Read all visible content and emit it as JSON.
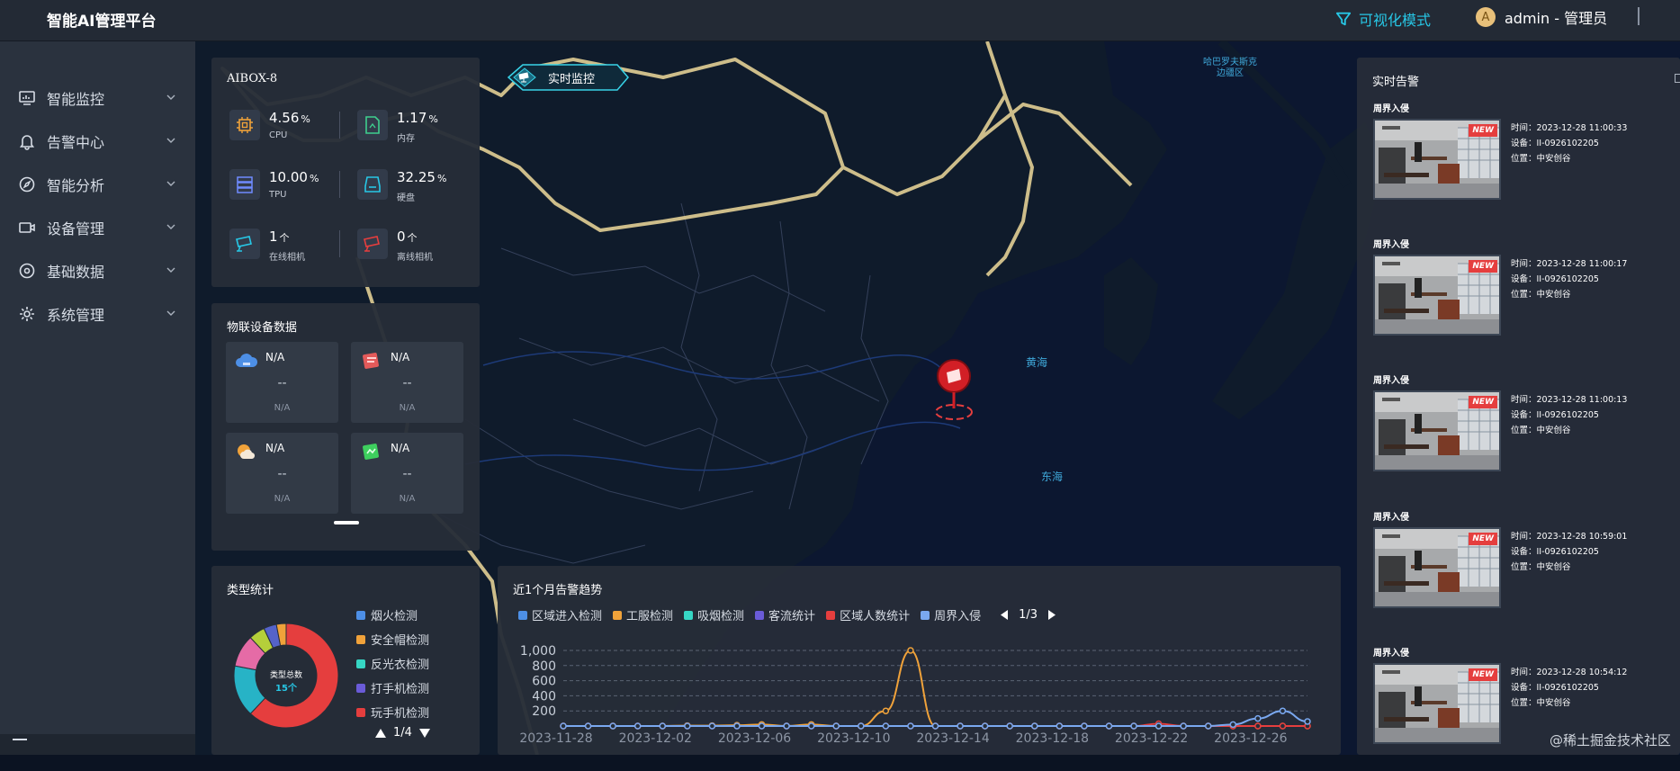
{
  "header": {
    "app_title": "智能AI管理平台",
    "visual_mode": "可视化模式",
    "avatar_initial": "A",
    "user_label": "admin - 管理员"
  },
  "sidebar": {
    "items": [
      {
        "label": "智能监控",
        "icon": "monitor-icon"
      },
      {
        "label": "告警中心",
        "icon": "bell-icon"
      },
      {
        "label": "智能分析",
        "icon": "compass-icon"
      },
      {
        "label": "设备管理",
        "icon": "camera-icon"
      },
      {
        "label": "基础数据",
        "icon": "disc-icon"
      },
      {
        "label": "系统管理",
        "icon": "gear-icon"
      }
    ]
  },
  "map": {
    "monitor_button": "实时监控",
    "labels": {
      "yellow_sea": "黄海",
      "east_sea": "东海",
      "region": "哈巴罗夫斯克边疆区"
    }
  },
  "device_panel": {
    "title": "AIBOX-8",
    "stats": [
      {
        "value": "4.56",
        "unit": "%",
        "label": "CPU",
        "color": "#f0a23a"
      },
      {
        "value": "1.17",
        "unit": "%",
        "label": "内存",
        "color": "#3ecf8e"
      },
      {
        "value": "10.00",
        "unit": "%",
        "label": "TPU",
        "color": "#6f8bff"
      },
      {
        "value": "32.25",
        "unit": "%",
        "label": "硬盘",
        "color": "#27c7e6"
      },
      {
        "value": "1",
        "unit": "个",
        "label": "在线相机",
        "color": "#27c7e6"
      },
      {
        "value": "0",
        "unit": "个",
        "label": "离线相机",
        "color": "#e53e3e"
      }
    ]
  },
  "iot_panel": {
    "title": "物联设备数据",
    "cards": [
      {
        "title": "N/A",
        "value": "--",
        "sub": "N/A",
        "color": "#4d8fe6"
      },
      {
        "title": "N/A",
        "value": "--",
        "sub": "N/A",
        "color": "#e35a5a"
      },
      {
        "title": "N/A",
        "value": "--",
        "sub": "N/A",
        "color": "#f0a23a"
      },
      {
        "title": "N/A",
        "value": "--",
        "sub": "N/A",
        "color": "#3ecf5e"
      }
    ]
  },
  "type_panel": {
    "title": "类型统计",
    "center_label": "类型总数",
    "center_value": "15个",
    "pager": "1/4",
    "legend": [
      {
        "name": "烟火检测",
        "color": "#4d8fe6"
      },
      {
        "name": "安全帽检测",
        "color": "#f0a23a"
      },
      {
        "name": "反光衣检测",
        "color": "#36d6c4"
      },
      {
        "name": "打手机检测",
        "color": "#6a5bd8"
      },
      {
        "name": "玩手机检测",
        "color": "#e53e3e"
      }
    ],
    "chart_data": {
      "type": "pie",
      "values": [
        62,
        16,
        10,
        5,
        4,
        3
      ],
      "colors": [
        "#e53e3e",
        "#27b3c6",
        "#e56ba6",
        "#b5cf3a",
        "#5563c9",
        "#f0a23a"
      ]
    }
  },
  "trend_panel": {
    "title": "近1个月告警趋势",
    "pager": "1/3",
    "legend": [
      {
        "name": "区域进入检测",
        "color": "#4d8fe6"
      },
      {
        "name": "工服检测",
        "color": "#f0a23a"
      },
      {
        "name": "吸烟检测",
        "color": "#36d6c4"
      },
      {
        "name": "客流统计",
        "color": "#6a5bd8"
      },
      {
        "name": "区域人数统计",
        "color": "#e53e3e"
      },
      {
        "name": "周界入侵",
        "color": "#7aa8f0"
      }
    ],
    "chart_data": {
      "type": "line",
      "x": [
        "2023-11-28",
        "2023-11-29",
        "2023-11-30",
        "2023-12-01",
        "2023-12-02",
        "2023-12-03",
        "2023-12-04",
        "2023-12-05",
        "2023-12-06",
        "2023-12-07",
        "2023-12-08",
        "2023-12-09",
        "2023-12-10",
        "2023-12-11",
        "2023-12-12",
        "2023-12-13",
        "2023-12-14",
        "2023-12-15",
        "2023-12-16",
        "2023-12-17",
        "2023-12-18",
        "2023-12-19",
        "2023-12-20",
        "2023-12-21",
        "2023-12-22",
        "2023-12-23",
        "2023-12-24",
        "2023-12-25",
        "2023-12-26",
        "2023-12-27",
        "2023-12-28"
      ],
      "xticks": [
        "2023-11-28",
        "2023-12-02",
        "2023-12-06",
        "2023-12-10",
        "2023-12-14",
        "2023-12-18",
        "2023-12-22",
        "2023-12-26"
      ],
      "yticks": [
        200,
        400,
        600,
        800,
        "1,000"
      ],
      "ylim": [
        0,
        1100
      ],
      "series": [
        {
          "name": "工服检测",
          "color": "#f0a23a",
          "values": [
            0,
            0,
            0,
            0,
            0,
            5,
            5,
            10,
            20,
            0,
            20,
            0,
            0,
            200,
            1000,
            0,
            0,
            0,
            0,
            0,
            0,
            0,
            0,
            0,
            0,
            0,
            0,
            0,
            0,
            0,
            0
          ]
        },
        {
          "name": "区域人数统计",
          "color": "#e53e3e",
          "values": [
            0,
            0,
            0,
            0,
            0,
            0,
            0,
            0,
            0,
            0,
            0,
            0,
            0,
            0,
            0,
            0,
            0,
            0,
            0,
            0,
            0,
            0,
            0,
            0,
            30,
            0,
            0,
            0,
            0,
            0,
            0
          ]
        },
        {
          "name": "周界入侵",
          "color": "#7aa8f0",
          "values": [
            0,
            0,
            0,
            0,
            0,
            0,
            0,
            0,
            0,
            0,
            0,
            0,
            0,
            0,
            0,
            0,
            0,
            0,
            0,
            0,
            0,
            0,
            0,
            0,
            0,
            0,
            0,
            20,
            100,
            200,
            60
          ]
        }
      ]
    }
  },
  "alert_panel": {
    "title": "实时告警",
    "new_tag": "NEW",
    "alerts": [
      {
        "type": "周界入侵",
        "time": "时间：2023-12-28 11:00:33",
        "device": "设备：II-0926102205",
        "location": "位置：中安创谷"
      },
      {
        "type": "周界入侵",
        "time": "时间：2023-12-28 11:00:17",
        "device": "设备：II-0926102205",
        "location": "位置：中安创谷"
      },
      {
        "type": "周界入侵",
        "time": "时间：2023-12-28 11:00:13",
        "device": "设备：II-0926102205",
        "location": "位置：中安创谷"
      },
      {
        "type": "周界入侵",
        "time": "时间：2023-12-28 10:59:01",
        "device": "设备：II-0926102205",
        "location": "位置：中安创谷"
      },
      {
        "type": "周界入侵",
        "time": "时间：2023-12-28 10:54:12",
        "device": "设备：II-0926102205",
        "location": "位置：中安创谷"
      }
    ]
  },
  "watermark": "@稀土掘金技术社区"
}
